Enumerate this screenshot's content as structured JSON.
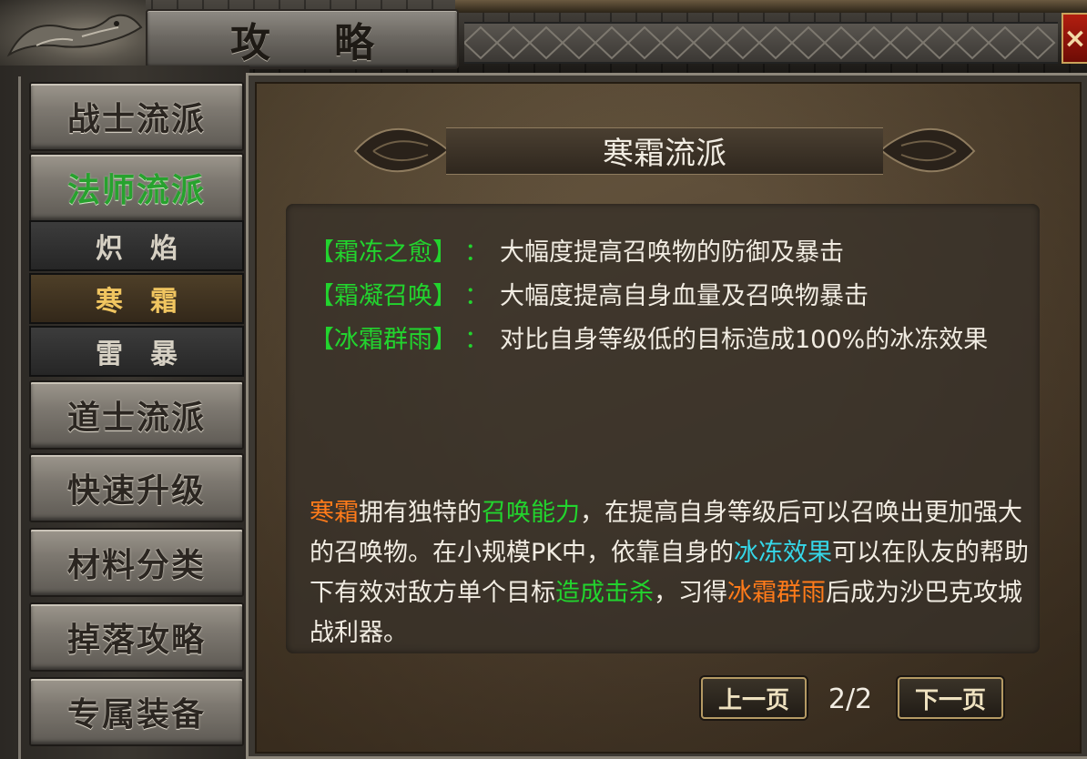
{
  "window": {
    "title_chars": [
      "攻",
      "略"
    ],
    "close_symbol": "×"
  },
  "sidebar": {
    "items": [
      {
        "label": "战士流派"
      },
      {
        "label": "法师流派",
        "active": true,
        "subitems": [
          {
            "label": "炽焰"
          },
          {
            "label": "寒霜",
            "selected": true
          },
          {
            "label": "雷暴"
          }
        ]
      },
      {
        "label": "道士流派"
      },
      {
        "label": "快速升级"
      },
      {
        "label": "材料分类"
      },
      {
        "label": "掉落攻略"
      },
      {
        "label": "专属装备"
      }
    ]
  },
  "content": {
    "heading": "寒霜流派",
    "skills": [
      {
        "name": "【霜冻之愈】",
        "colon": "：",
        "desc": "大幅度提高召唤物的防御及暴击"
      },
      {
        "name": "【霜凝召唤】",
        "colon": "：",
        "desc": "大幅度提高自身血量及召唤物暴击"
      },
      {
        "name": "【冰霜群雨】",
        "colon": "：",
        "desc": "对比自身等级低的目标造成100%的冰冻效果"
      }
    ],
    "description": {
      "p1": "寒霜",
      "p2": "拥有独特的",
      "p3": "召唤能力",
      "p4": "，在提高自身等级后可以召唤出更加强大的召唤物。在小规模PK中，依靠自身的",
      "p5": "冰冻效果",
      "p6": "可以在队友的帮助下有效对敌方单个目标",
      "p7": "造成击杀",
      "p8": "，习得",
      "p9": "冰霜群雨",
      "p10": "后成为沙巴克攻城战利器。"
    }
  },
  "pager": {
    "prev_label": "上一页",
    "next_label": "下一页",
    "indicator": "2/2"
  },
  "colors": {
    "skill_green": "#22d42e",
    "highlight_orange": "#ff7b1a",
    "highlight_cyan": "#35d7e8",
    "active_menu_green": "#27a22e",
    "selected_sub_gold": "#f0c560"
  }
}
